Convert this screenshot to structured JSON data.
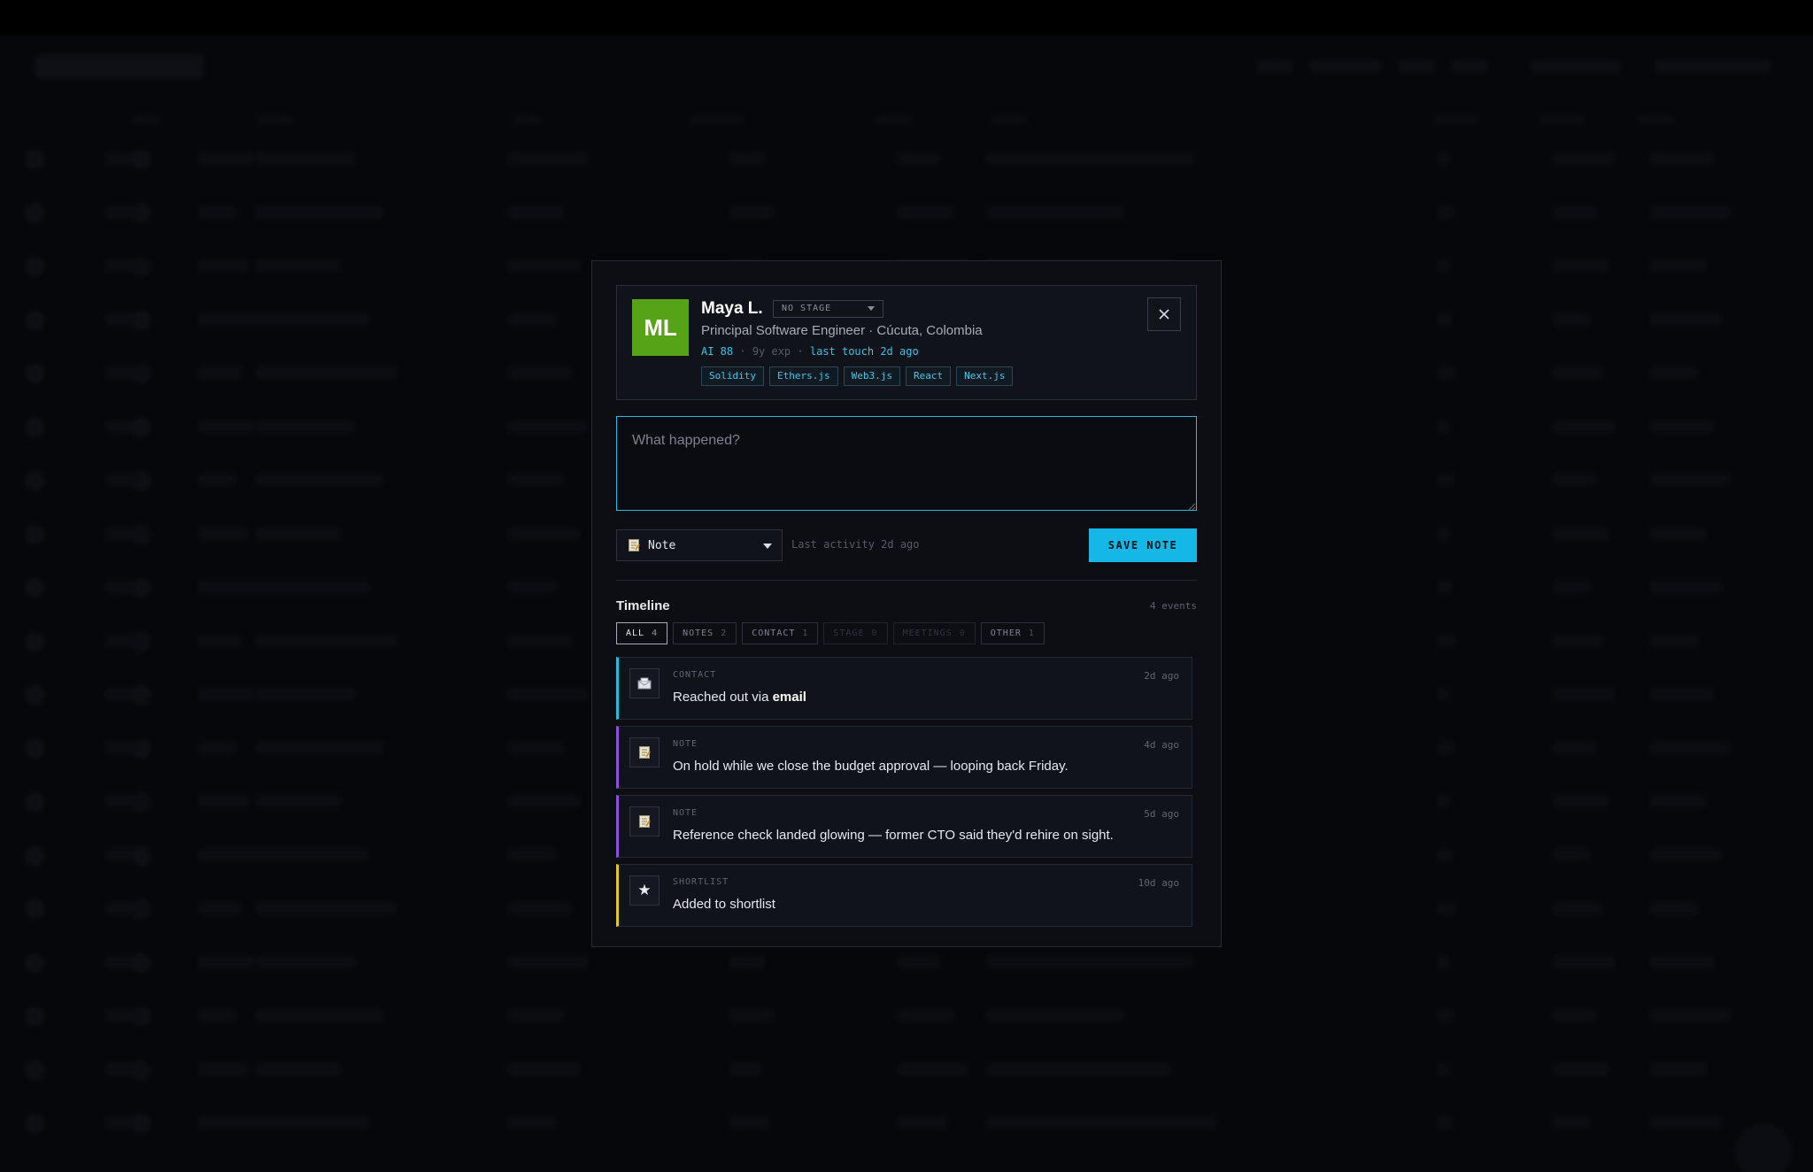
{
  "candidate": {
    "initials": "ML",
    "name": "Maya L.",
    "stage": "NO STAGE",
    "subtitle": "Principal Software Engineer · Cúcuta, Colombia",
    "ai_score": "AI 88",
    "experience": "9y exp",
    "last_touch": "last touch 2d ago",
    "tags": [
      "Solidity",
      "Ethers.js",
      "Web3.js",
      "React",
      "Next.js"
    ],
    "avatar_color": "#57a318"
  },
  "composer": {
    "placeholder": "What happened?",
    "type_value": "Note",
    "last_activity": "Last activity 2d ago",
    "save_label": "SAVE NOTE"
  },
  "timeline": {
    "title": "Timeline",
    "count": "4 events",
    "filters": [
      {
        "label": "ALL",
        "count": "4"
      },
      {
        "label": "NOTES",
        "count": "2"
      },
      {
        "label": "CONTACT",
        "count": "1"
      },
      {
        "label": "STAGE",
        "count": "0"
      },
      {
        "label": "MEETINGS",
        "count": "0"
      },
      {
        "label": "OTHER",
        "count": "1"
      }
    ],
    "events": [
      {
        "kind": "CONTACT",
        "text_prefix": "Reached out via ",
        "text_strong": "email",
        "time": "2d ago",
        "icon": "envelope-icon"
      },
      {
        "kind": "NOTE",
        "text": "On hold while we close the budget approval — looping back Friday.",
        "time": "4d ago",
        "icon": "memo-icon"
      },
      {
        "kind": "NOTE",
        "text": "Reference check landed glowing — former CTO said they'd rehire on sight.",
        "time": "5d ago",
        "icon": "memo-icon"
      },
      {
        "kind": "SHORTLIST",
        "text": "Added to shortlist",
        "time": "10d ago",
        "icon": "star-icon"
      }
    ]
  },
  "colors": {
    "accent": "#14b8e6",
    "contact_bar": "#2fb8d8",
    "note_bar": "#8a52d8",
    "shortlist_bar": "#e2c62a"
  }
}
